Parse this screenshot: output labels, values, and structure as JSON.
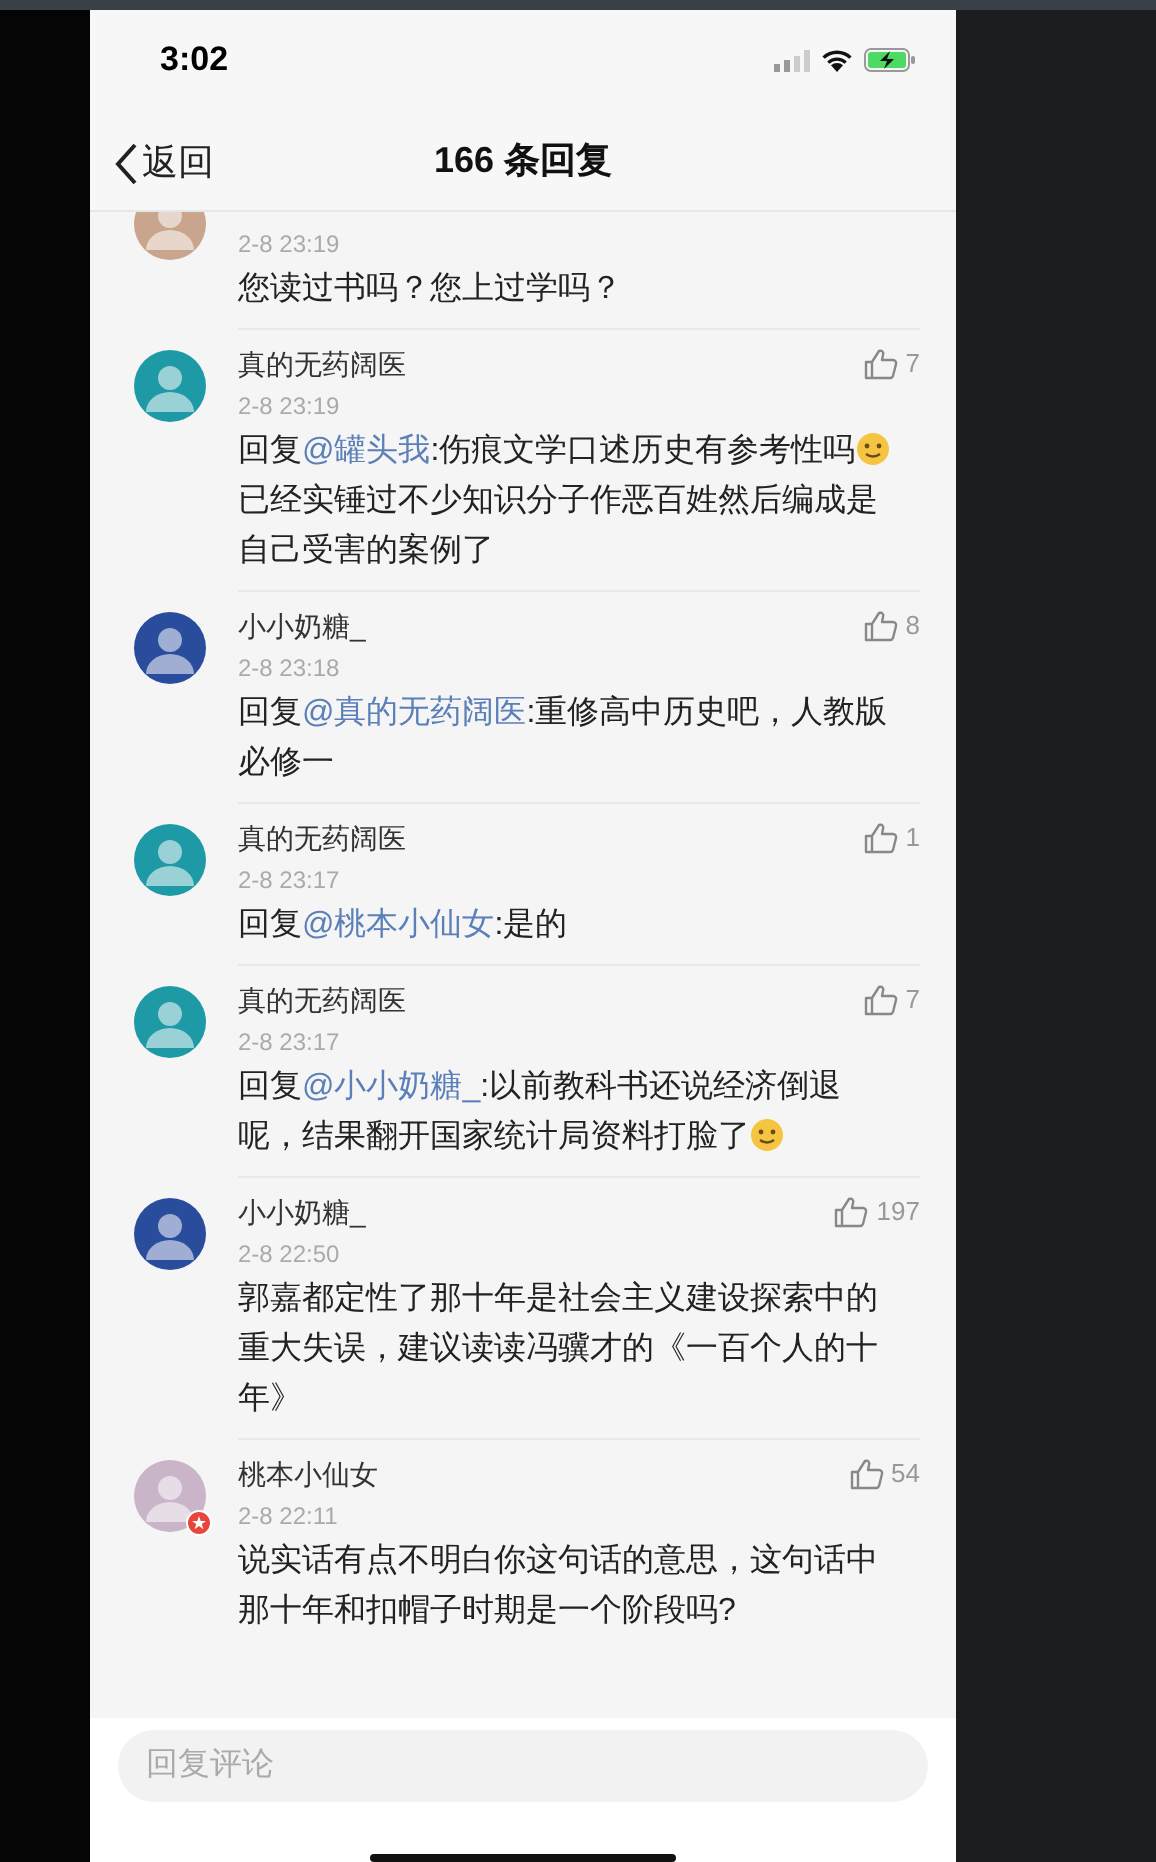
{
  "status_bar": {
    "time": "3:02"
  },
  "nav": {
    "back": "返回",
    "title": "166 条回复"
  },
  "comments": [
    {
      "color": "#c8a58c",
      "verified": false,
      "date": "2-8 23:19",
      "body": [
        {
          "kind": "text",
          "text": "您读过书吗？您上过学吗？"
        }
      ]
    },
    {
      "name": "真的无药阔医",
      "likes": "7",
      "color": "#1e9aa6",
      "verified": false,
      "date": "2-8 23:19",
      "body": [
        {
          "kind": "text",
          "text": "回复"
        },
        {
          "kind": "mention",
          "text": "@罐头我"
        },
        {
          "kind": "text",
          "text": ":伤痕文学口述历史有参考性吗"
        },
        {
          "kind": "emoji"
        },
        {
          "kind": "text",
          "text": "已经实锤过不少知识分子作恶百姓然后编成是自己受害的案例了"
        }
      ]
    },
    {
      "name": "小小奶糖_",
      "likes": "8",
      "color": "#2a4c9c",
      "verified": false,
      "date": "2-8 23:18",
      "body": [
        {
          "kind": "text",
          "text": "回复"
        },
        {
          "kind": "mention",
          "text": "@真的无药阔医"
        },
        {
          "kind": "text",
          "text": ":重修高中历史吧，人教版必修一"
        }
      ]
    },
    {
      "name": "真的无药阔医",
      "likes": "1",
      "color": "#1e9aa6",
      "verified": false,
      "date": "2-8 23:17",
      "body": [
        {
          "kind": "text",
          "text": "回复"
        },
        {
          "kind": "mention",
          "text": "@桃本小仙女"
        },
        {
          "kind": "text",
          "text": ":是的"
        }
      ]
    },
    {
      "name": "真的无药阔医",
      "likes": "7",
      "color": "#1e9aa6",
      "verified": false,
      "date": "2-8 23:17",
      "body": [
        {
          "kind": "text",
          "text": "回复"
        },
        {
          "kind": "mention",
          "text": "@小小奶糖_"
        },
        {
          "kind": "text",
          "text": ":以前教科书还说经济倒退呢，结果翻开国家统计局资料打脸了"
        },
        {
          "kind": "emoji"
        }
      ]
    },
    {
      "name": "小小奶糖_",
      "likes": "197",
      "color": "#2a4c9c",
      "verified": false,
      "date": "2-8 22:50",
      "body": [
        {
          "kind": "text",
          "text": "郭嘉都定性了那十年是社会主义建设探索中的重大失误，建议读读冯骥才的《一百个人的十年》"
        }
      ]
    },
    {
      "name": "桃本小仙女",
      "likes": "54",
      "color": "#c9b4c8",
      "verified": true,
      "date": "2-8 22:11",
      "body": [
        {
          "kind": "text",
          "text": "说实话有点不明白你这句话的意思，这句话中那十年和扣帽子时期是一个阶段吗?"
        }
      ]
    }
  ],
  "reply_bar": {
    "placeholder": "回复评论"
  }
}
